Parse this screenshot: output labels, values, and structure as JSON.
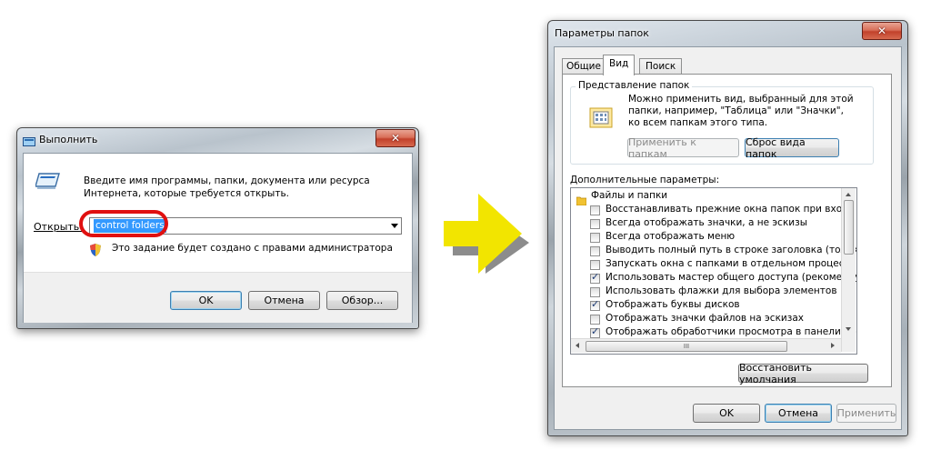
{
  "run_dialog": {
    "title": "Выполнить",
    "description_line1": "Введите имя программы, папки, документа или ресурса",
    "description_line2": "Интернета, которые требуется открыть.",
    "open_label": "Открыть:",
    "open_value": "control folders",
    "admin_note": "Это задание будет создано с правами администратора",
    "ok": "OK",
    "cancel": "Отмена",
    "browse": "Обзор..."
  },
  "folder_options": {
    "title": "Параметры папок",
    "tabs": [
      "Общие",
      "Вид",
      "Поиск"
    ],
    "active_tab": "Вид",
    "views_group_label": "Представление папок",
    "views_text_line1": "Можно применить вид, выбранный для этой",
    "views_text_line2": "папки, например, \"Таблица\" или \"Значки\",",
    "views_text_line3": "ко всем папкам этого типа.",
    "apply_to_folders": "Применить к папкам",
    "reset_folders": "Сброс вида папок",
    "advanced_label": "Дополнительные параметры:",
    "tree_root": "Файлы и папки",
    "items": [
      {
        "label": "Восстанавливать прежние окна папок при входе в си",
        "checked": false
      },
      {
        "label": "Всегда отображать значки, а не эскизы",
        "checked": false
      },
      {
        "label": "Всегда отображать меню",
        "checked": false
      },
      {
        "label": "Выводить полный путь в строке заголовка (только д",
        "checked": false
      },
      {
        "label": "Запускать окна с папками в отдельном процессе",
        "checked": false
      },
      {
        "label": "Использовать мастер общего доступа (рекомендует",
        "checked": true
      },
      {
        "label": "Использовать флажки для выбора элементов",
        "checked": false
      },
      {
        "label": "Отображать буквы дисков",
        "checked": true
      },
      {
        "label": "Отображать значки файлов на эскизах",
        "checked": false
      },
      {
        "label": "Отображать обработчики просмотра в панели просм",
        "checked": true
      }
    ],
    "hscroll_grip": "III",
    "restore_defaults": "Восстановить умолчания",
    "ok": "OK",
    "cancel": "Отмена",
    "apply": "Применить"
  },
  "colors": {
    "highlight_circle": "#e01010",
    "arrow": "#f2e500",
    "arrow_shadow": "#8c8c8c",
    "selection": "#3399ff"
  }
}
